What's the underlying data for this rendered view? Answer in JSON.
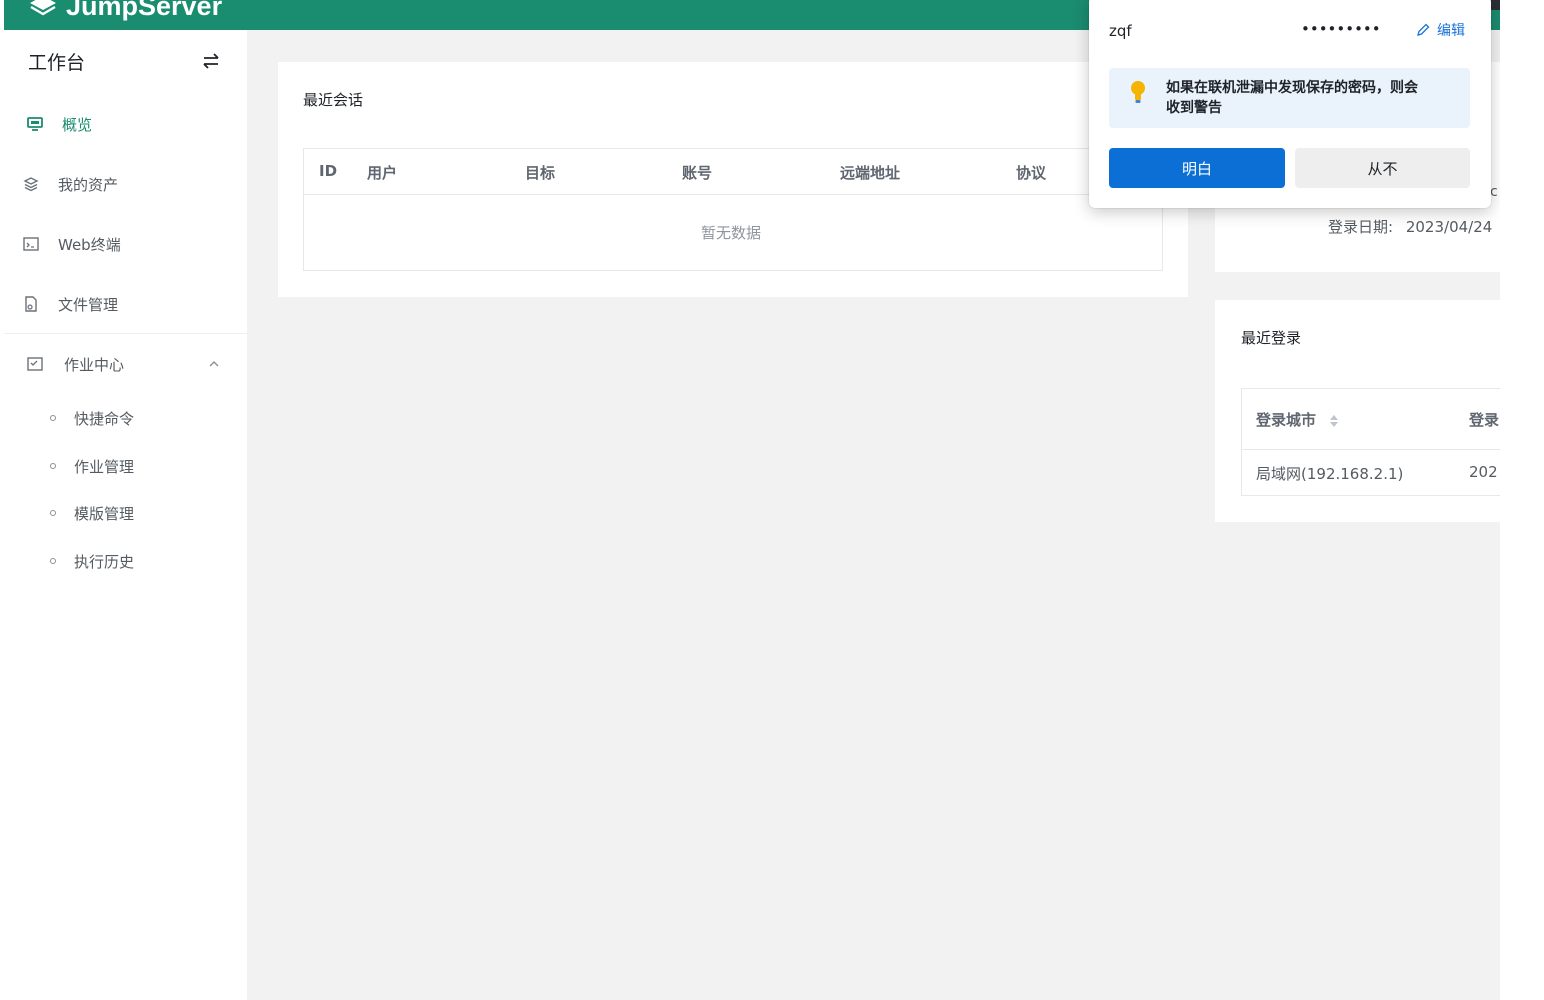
{
  "app": {
    "name": "JumpServer"
  },
  "colors": {
    "brand": "#1a8c6f",
    "primary_button": "#0b6fd6",
    "warning_bg": "#eaf2fb"
  },
  "sidebar": {
    "title": "工作台",
    "toggle_icon": "swap-icon",
    "items": [
      {
        "label": "概览",
        "icon": "monitor-icon",
        "active": true
      },
      {
        "label": "我的资产",
        "icon": "layers-icon",
        "active": false
      },
      {
        "label": "Web终端",
        "icon": "terminal-icon",
        "active": false
      },
      {
        "label": "文件管理",
        "icon": "file-icon",
        "active": false
      }
    ],
    "group": {
      "label": "作业中心",
      "icon": "task-icon",
      "expanded": true,
      "children": [
        {
          "label": "快捷命令"
        },
        {
          "label": "作业管理"
        },
        {
          "label": "模版管理"
        },
        {
          "label": "执行历史"
        }
      ]
    }
  },
  "recent_sessions": {
    "title": "最近会话",
    "columns": [
      "ID",
      "用户",
      "目标",
      "账号",
      "远端地址",
      "协议"
    ],
    "empty_text": "暂无数据"
  },
  "user_info": {
    "fragment": "c",
    "login_date_label": "登录日期:",
    "login_date_value": "2023/04/24"
  },
  "recent_logins": {
    "title": "最近登录",
    "columns": [
      "登录城市",
      "登录"
    ],
    "rows": [
      {
        "city": "局域网(192.168.2.1)",
        "date": "202"
      }
    ]
  },
  "password_popup": {
    "username": "zqf",
    "password_mask": "•••••••••",
    "edit_label": "编辑",
    "warning_line1": "如果在联机泄漏中发现保存的密码，则会",
    "warning_line2": "收到警告",
    "ok_label": "明白",
    "never_label": "从不"
  }
}
